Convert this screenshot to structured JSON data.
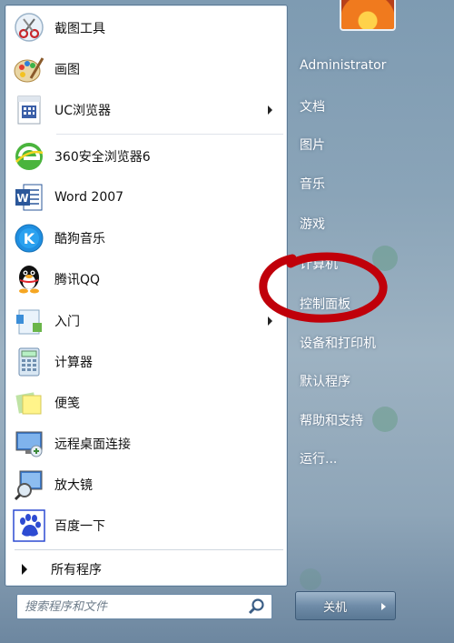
{
  "programs": [
    {
      "label": "截图工具",
      "icon": "snipping-tool-icon",
      "has_arrow": false
    },
    {
      "label": "画图",
      "icon": "paint-icon",
      "has_arrow": false
    },
    {
      "label": "UC浏览器",
      "icon": "uc-browser-icon",
      "has_arrow": true
    },
    {
      "label": "360安全浏览器6",
      "icon": "360-browser-icon",
      "has_arrow": false
    },
    {
      "label": "Word 2007",
      "icon": "word-icon",
      "has_arrow": false
    },
    {
      "label": "酷狗音乐",
      "icon": "kugou-music-icon",
      "has_arrow": false
    },
    {
      "label": "腾讯QQ",
      "icon": "qq-penguin-icon",
      "has_arrow": false
    },
    {
      "label": "入门",
      "icon": "getting-started-icon",
      "has_arrow": true
    },
    {
      "label": "计算器",
      "icon": "calculator-icon",
      "has_arrow": false
    },
    {
      "label": "便笺",
      "icon": "sticky-notes-icon",
      "has_arrow": false
    },
    {
      "label": "远程桌面连接",
      "icon": "remote-desktop-icon",
      "has_arrow": false
    },
    {
      "label": "放大镜",
      "icon": "magnifier-icon",
      "has_arrow": false
    },
    {
      "label": "百度一下",
      "icon": "baidu-paw-icon",
      "has_arrow": false
    }
  ],
  "all_programs": "所有程序",
  "search": {
    "placeholder": "搜索程序和文件"
  },
  "right": {
    "user": "Administrator",
    "items": [
      "文档",
      "图片",
      "音乐",
      "游戏",
      "计算机",
      "控制面板",
      "设备和打印机",
      "默认程序",
      "帮助和支持",
      "运行..."
    ]
  },
  "shutdown_label": "关机",
  "colors": {
    "annotation": "#c0000a",
    "pane_bg": "#ffffff",
    "accent": "#3a6ea5"
  }
}
